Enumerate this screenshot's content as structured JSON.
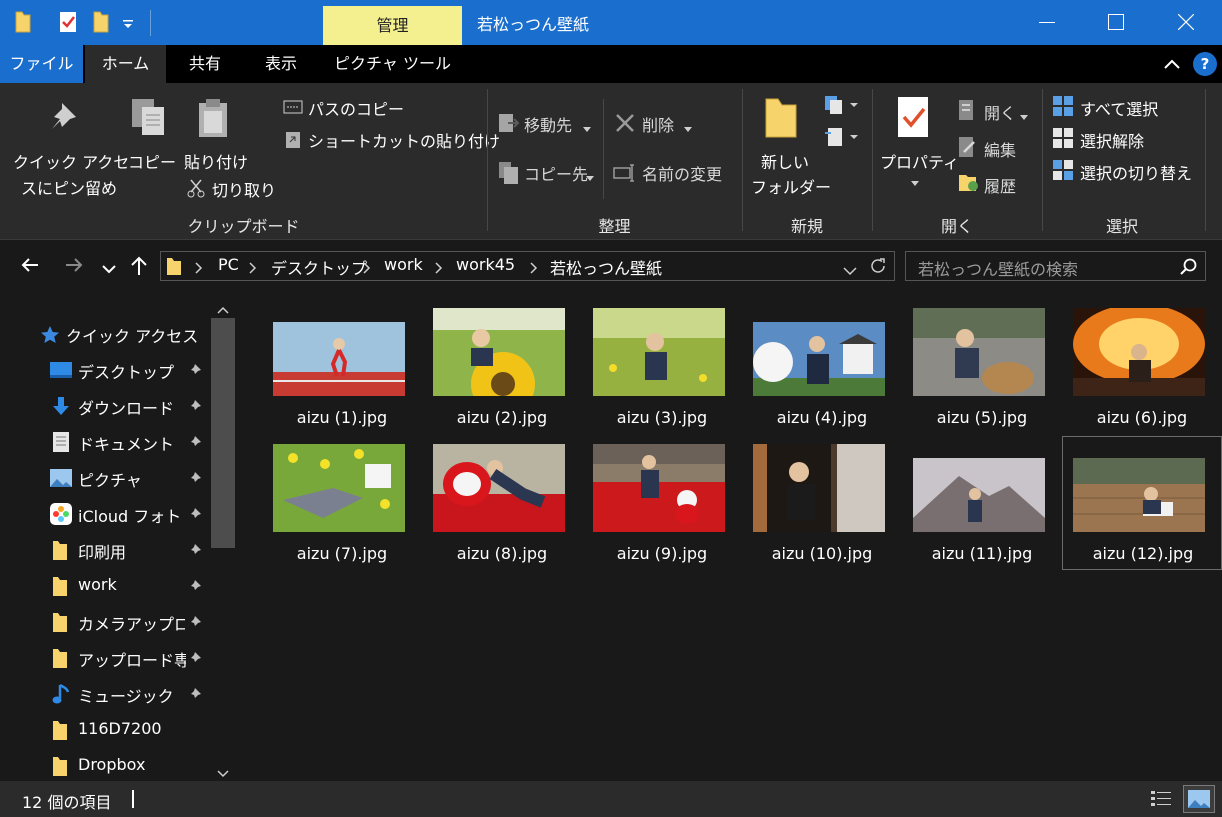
{
  "titlebar": {
    "title": "若松っつん壁紙",
    "manage_tab": "管理"
  },
  "tabs": {
    "file": "ファイル",
    "home": "ホーム",
    "share": "共有",
    "view": "表示",
    "picture_tools": "ピクチャ ツール"
  },
  "ribbon": {
    "clipboard": {
      "pin_quick_access_line1": "クイック アクセ",
      "pin_quick_access_line2": "スにピン留め",
      "copy": "コピー",
      "paste": "貼り付け",
      "copy_path": "パスのコピー",
      "paste_shortcut": "ショートカットの貼り付け",
      "cut": "切り取り",
      "label": "クリップボード"
    },
    "organize": {
      "move_to": "移動先",
      "copy_to": "コピー先",
      "delete": "削除",
      "rename": "名前の変更",
      "label": "整理"
    },
    "new": {
      "new_folder_line1": "新しい",
      "new_folder_line2": "フォルダー",
      "label": "新規"
    },
    "open": {
      "properties": "プロパティ",
      "open": "開く",
      "edit": "編集",
      "history": "履歴",
      "label": "開く"
    },
    "select": {
      "select_all": "すべて選択",
      "select_none": "選択解除",
      "invert_selection": "選択の切り替え",
      "label": "選択"
    }
  },
  "address": {
    "crumbs": [
      "PC",
      "デスクトップ",
      "work",
      "work45",
      "若松っつん壁紙"
    ],
    "search_placeholder": "若松っつん壁紙の検索"
  },
  "sidebar": {
    "quick_access": "クイック アクセス",
    "items": [
      {
        "label": "デスクトップ",
        "icon": "desktop-icon",
        "pinned": true
      },
      {
        "label": "ダウンロード",
        "icon": "download-icon",
        "pinned": true
      },
      {
        "label": "ドキュメント",
        "icon": "documents-icon",
        "pinned": true
      },
      {
        "label": "ピクチャ",
        "icon": "pictures-icon",
        "pinned": true
      },
      {
        "label": "iCloud フォト",
        "icon": "icloud-photos-icon",
        "pinned": true
      },
      {
        "label": "印刷用",
        "icon": "folder-icon",
        "pinned": true
      },
      {
        "label": "work",
        "icon": "folder-icon",
        "pinned": true
      },
      {
        "label": "カメラアップロード",
        "icon": "folder-icon",
        "pinned": true
      },
      {
        "label": "アップロード専用",
        "icon": "folder-icon",
        "pinned": true
      },
      {
        "label": "ミュージック",
        "icon": "music-icon",
        "pinned": true
      },
      {
        "label": "116D7200",
        "icon": "folder-icon",
        "pinned": false
      },
      {
        "label": "Dropbox",
        "icon": "folder-icon",
        "pinned": false
      }
    ]
  },
  "files": [
    {
      "name": "aizu (1).jpg",
      "scene": "running on track",
      "selected": false
    },
    {
      "name": "aizu (2).jpg",
      "scene": "sunflower field",
      "selected": false
    },
    {
      "name": "aizu (3).jpg",
      "scene": "green meadow",
      "selected": false
    },
    {
      "name": "aizu (4).jpg",
      "scene": "castle and sky",
      "selected": false
    },
    {
      "name": "aizu (5).jpg",
      "scene": "riverside rocks",
      "selected": false
    },
    {
      "name": "aizu (6).jpg",
      "scene": "fire festival",
      "selected": false
    },
    {
      "name": "aizu (7).jpg",
      "scene": "dandelion grass",
      "selected": false
    },
    {
      "name": "aizu (8).jpg",
      "scene": "red daruma",
      "selected": false
    },
    {
      "name": "aizu (9).jpg",
      "scene": "red carpet",
      "selected": false
    },
    {
      "name": "aizu (10).jpg",
      "scene": "window sill",
      "selected": false
    },
    {
      "name": "aizu (11).jpg",
      "scene": "mountain dusk",
      "selected": false
    },
    {
      "name": "aizu (12).jpg",
      "scene": "wooden floor",
      "selected": true
    }
  ],
  "status": {
    "item_count": "12 個の項目"
  },
  "colors": {
    "titlebar": "#1a6fce",
    "manage_tab": "#f5f08f",
    "ribbon_bg": "#2b2b2b",
    "content_bg": "#191919"
  }
}
